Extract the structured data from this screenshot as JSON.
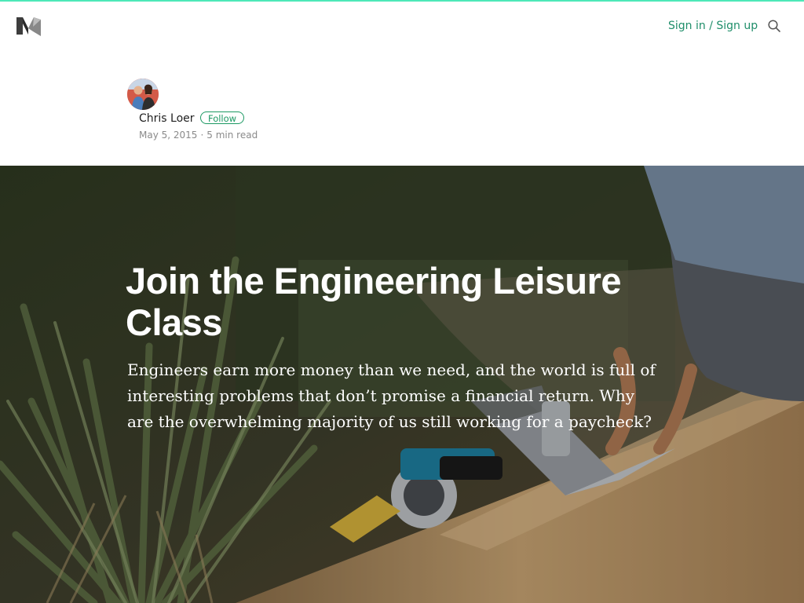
{
  "colors": {
    "accent_bar": "#4ee8b8",
    "brand_green": "#1c9963",
    "signin_green": "#1f8e6a",
    "hero_text": "#ffffff"
  },
  "header": {
    "logo_icon": "medium-logo-icon",
    "signin_label": "Sign in / Sign up",
    "search_icon": "search-icon"
  },
  "byline": {
    "avatar": "author-avatar",
    "author": "Chris Loer",
    "follow_label": "Follow",
    "date": "May 5, 2015",
    "separator": "·",
    "read_time": "5 min read"
  },
  "article": {
    "title": "Join the Engineering Leisure Class",
    "subtitle": "Engineers earn more money than we need, and the world is full of interesting problems that don’t promise a financial return. Why are the overwhelming majority of us still working for a paycheck?"
  }
}
